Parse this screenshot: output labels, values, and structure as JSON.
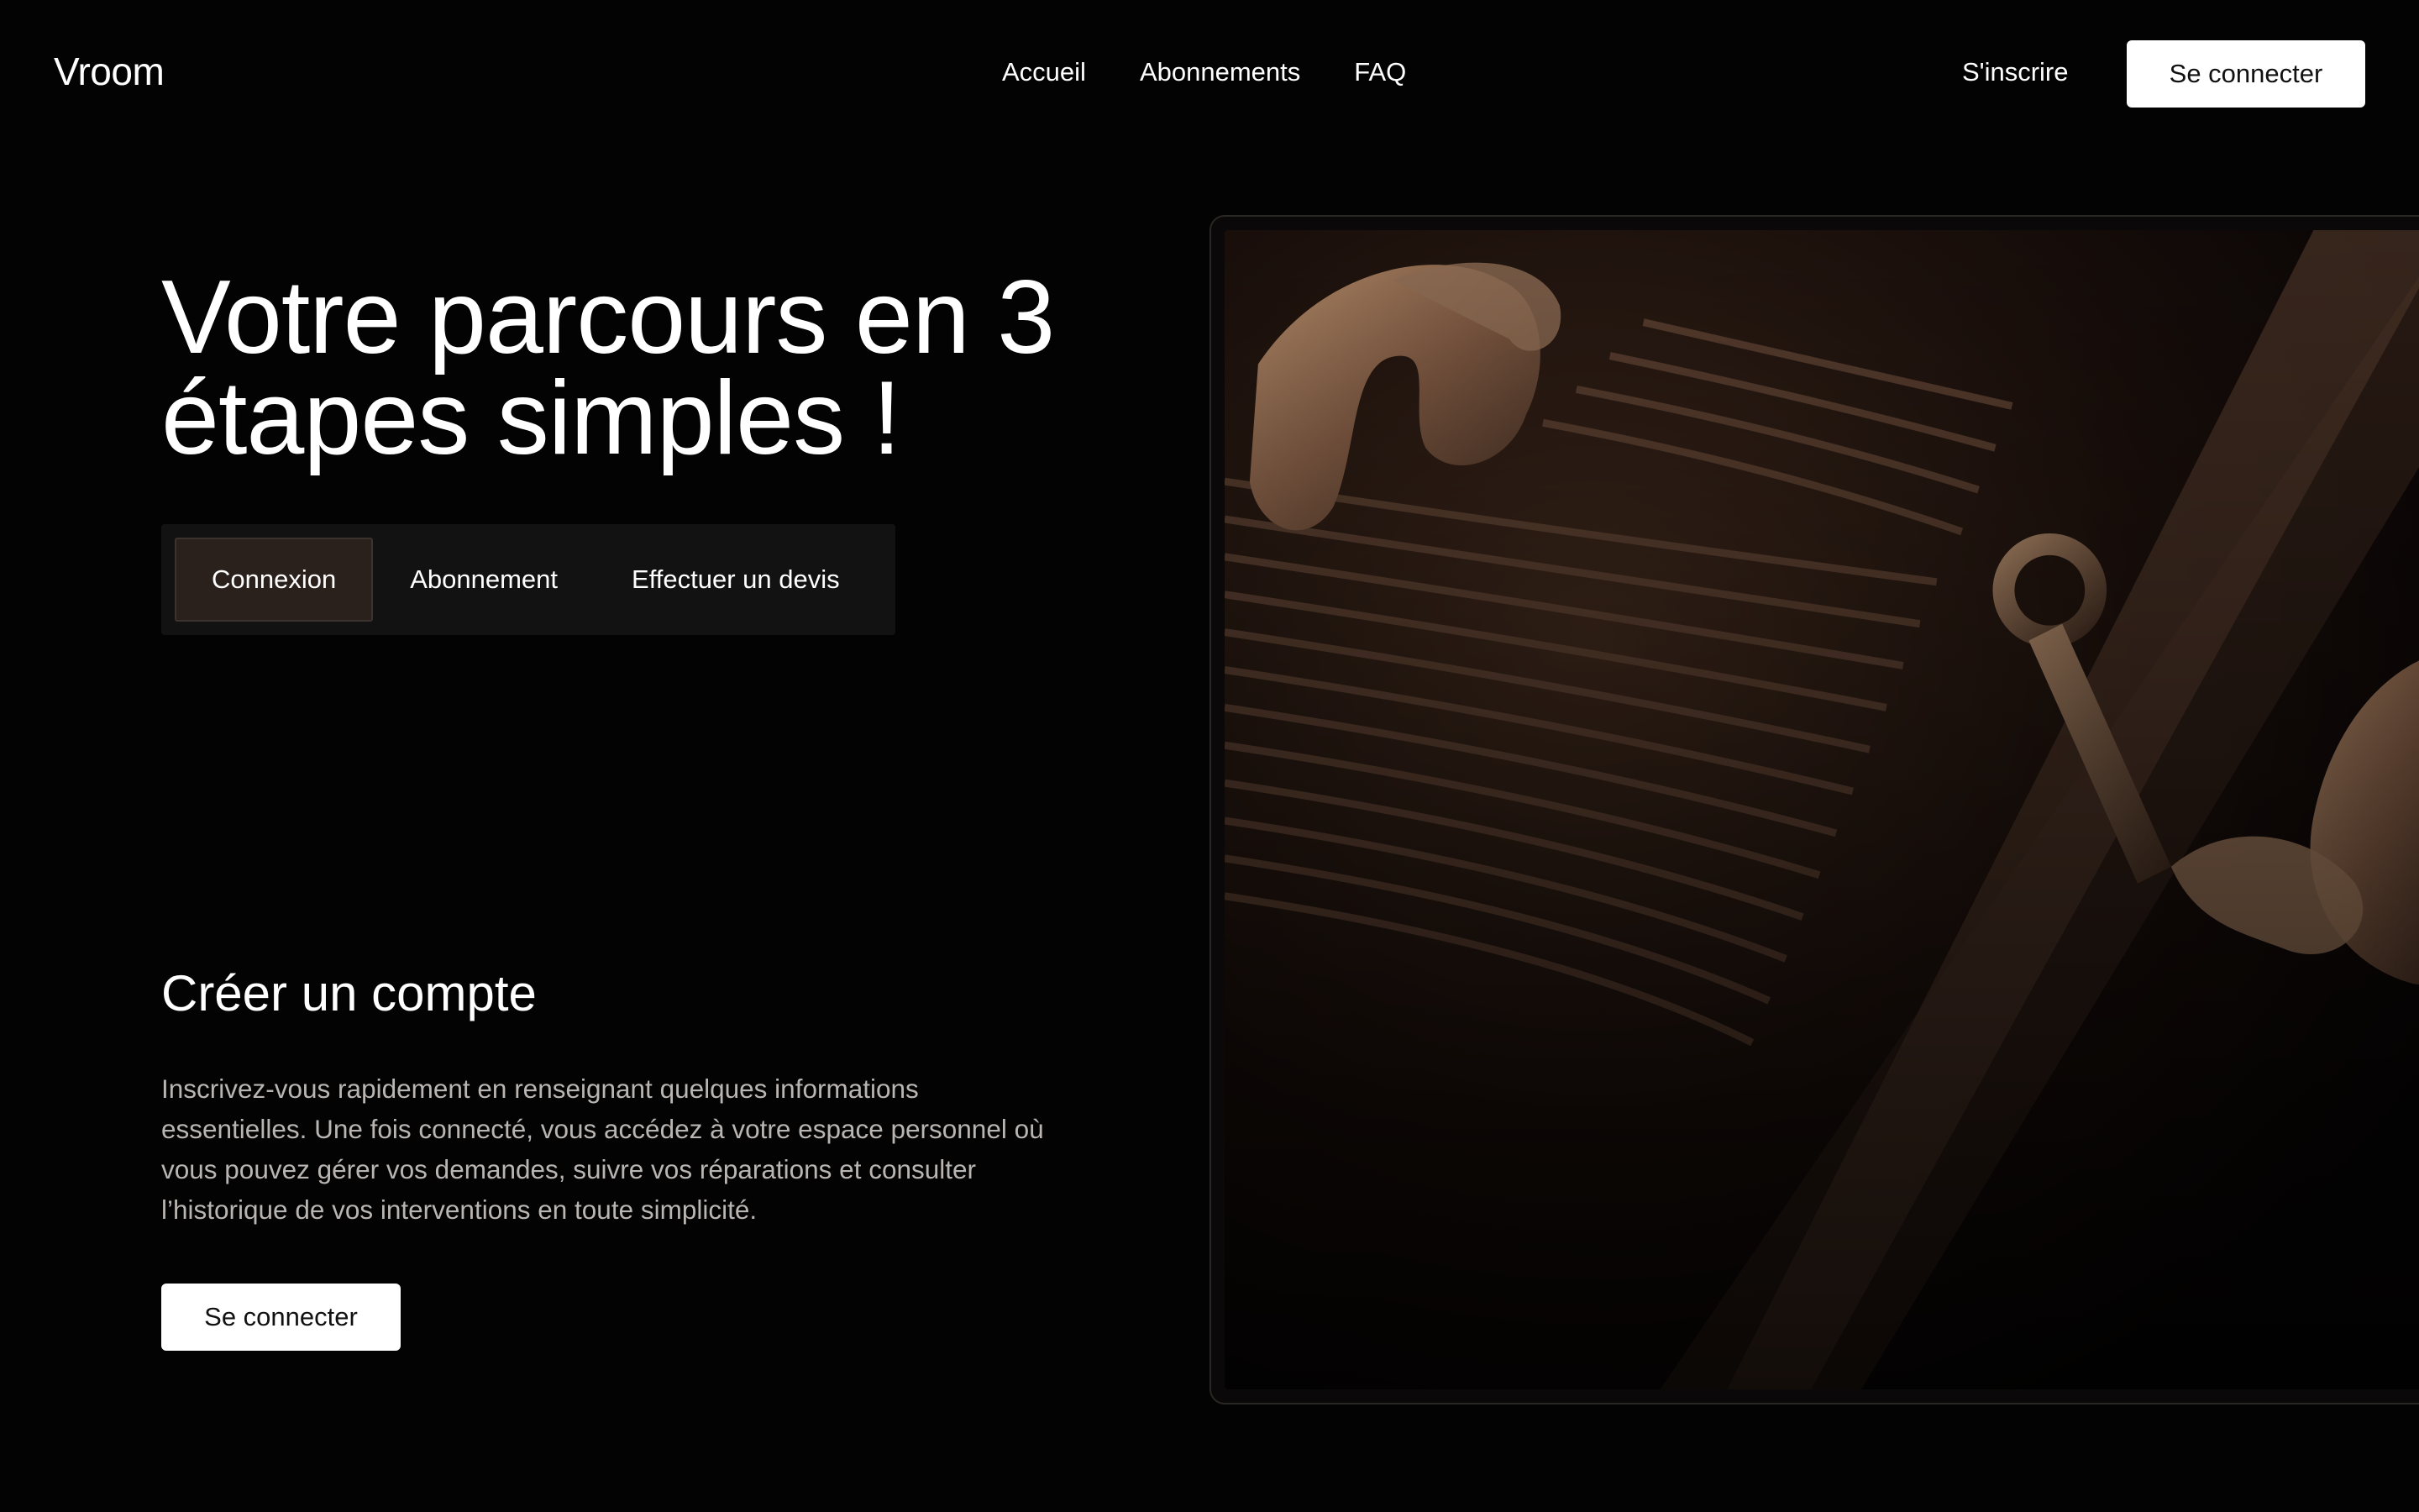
{
  "header": {
    "logo": "Vroom",
    "nav": [
      {
        "label": "Accueil"
      },
      {
        "label": "Abonnements"
      },
      {
        "label": "FAQ"
      }
    ],
    "signup_label": "S'inscrire",
    "login_label": "Se connecter"
  },
  "hero": {
    "title": "Votre parcours en 3 étapes simples !",
    "steps": [
      {
        "label": "Connexion",
        "active": true
      },
      {
        "label": "Abonnement",
        "active": false
      },
      {
        "label": "Effectuer un devis",
        "active": false
      }
    ]
  },
  "section": {
    "title": "Créer un compte",
    "text": "Inscrivez-vous rapidement en renseignant quelques informations essentielles. Une fois connecté, vous accédez à votre espace personnel où vous pouvez gérer vos demandes, suivre vos réparations et consulter l’historique de vos interventions en toute simplicité.",
    "cta_label": "Se connecter"
  },
  "image": {
    "subject": "mechanic-hands-engine-wrench",
    "tone": "#8a6a4f"
  },
  "colors": {
    "background": "#040303",
    "button_bg": "#ffffff",
    "tab_bar_bg": "#131212",
    "tab_active_bg": "#2a201c",
    "body_text": "#b9b5b2"
  }
}
